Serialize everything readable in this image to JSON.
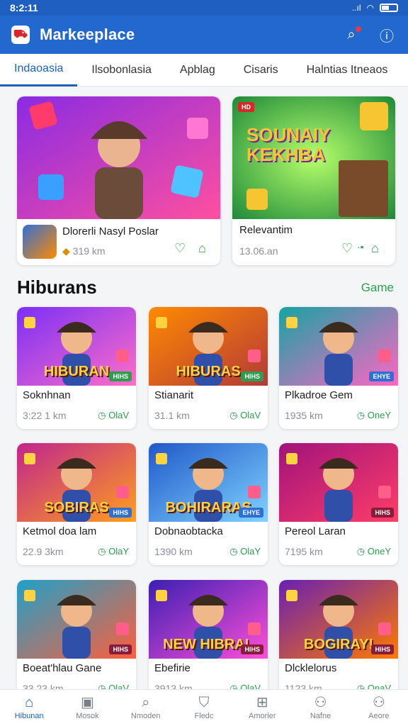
{
  "status": {
    "time": "8:2:11",
    "signal": "..ıl",
    "wifi": "◠"
  },
  "header": {
    "title": "Markeeplace",
    "logo": "marketplace-logo"
  },
  "tabs": [
    "Indaoasia",
    "Ilsobonlasia",
    "Apblag",
    "Cisaris",
    "Halntias Itneaos"
  ],
  "featured": [
    {
      "title": "Dlorerli Nasyl Poslar",
      "meta": "319 km",
      "colors": [
        "#8a2be2",
        "#ff4fa0"
      ]
    },
    {
      "title": "Relevantim",
      "meta": "13.06.an",
      "art_text": "SOUNAIY KEKHBA",
      "colors": [
        "#2ea043",
        "#f1c232"
      ]
    }
  ],
  "section": {
    "title": "Hiburans",
    "link": "Game"
  },
  "grid": [
    {
      "title": "Soknhnan",
      "meta": "3:22 1 km",
      "action": "OlaV",
      "art_text": "HIBURAN",
      "badge": "HIHS",
      "badge_color": "#2e9d4d",
      "colors": [
        "#7b2ff7",
        "#ff6ec7"
      ]
    },
    {
      "title": "Stianarit",
      "meta": "31.1 km",
      "action": "OlaV",
      "art_text": "HIBURAS",
      "badge": "HIHS",
      "badge_color": "#2e9d4d",
      "colors": [
        "#ff8a00",
        "#b33939"
      ]
    },
    {
      "title": "Plkadroe Gem",
      "meta": "1935 km",
      "action": "OneY",
      "art_text": "",
      "badge": "EHYE",
      "badge_color": "#2f6fd6",
      "colors": [
        "#16a3a3",
        "#ff66c4"
      ]
    },
    {
      "title": "Ketmol doa lam",
      "meta": "22.9 3km",
      "action": "OlaY",
      "art_text": "SOBIRAS",
      "badge": "HIHS",
      "badge_color": "#2f6fd6",
      "colors": [
        "#c0258d",
        "#ff9f1c"
      ]
    },
    {
      "title": "Dobnaobtacka",
      "meta": "1390 km",
      "action": "OlaY",
      "art_text": "BOHIRARAS",
      "badge": "EHYE",
      "badge_color": "#2f6fd6",
      "colors": [
        "#2058c9",
        "#7fd3ff"
      ]
    },
    {
      "title": "Pereol Laran",
      "meta": "7195 km",
      "action": "OneY",
      "art_text": "",
      "badge": "HIHS",
      "badge_color": "#8a1c3a",
      "colors": [
        "#a0137c",
        "#ff3d68"
      ]
    },
    {
      "title": "Boeat'hlau Gane",
      "meta": "33.23 km",
      "action": "OlaV",
      "art_text": "",
      "badge": "HIHS",
      "badge_color": "#8a1c3a",
      "colors": [
        "#1fa0c9",
        "#ff5e3a"
      ]
    },
    {
      "title": "Ebefirie",
      "meta": "3913 km",
      "action": "OlaV",
      "art_text": "NEW HIBRAL",
      "badge": "HIHS",
      "badge_color": "#8a1c3a",
      "colors": [
        "#3b1fb2",
        "#ff4fd8"
      ]
    },
    {
      "title": "Dlcklelorus",
      "meta": "1123 km",
      "action": "OnaV",
      "art_text": "BOGIRAY!",
      "badge": "HIHS",
      "badge_color": "#8a1c3a",
      "colors": [
        "#6a1fb2",
        "#ff7a00"
      ]
    }
  ],
  "bottom_nav": [
    {
      "label": "Hibunan",
      "icon": "home-icon",
      "glyph": "⌂"
    },
    {
      "label": "Mosok",
      "icon": "gallery-icon",
      "glyph": "▣"
    },
    {
      "label": "Nmoden",
      "icon": "search-icon",
      "glyph": "⌕"
    },
    {
      "label": "Fledc",
      "icon": "gift-icon",
      "glyph": "⛉"
    },
    {
      "label": "Amorier",
      "icon": "photo-icon",
      "glyph": "⊞"
    },
    {
      "label": "Nafne",
      "icon": "profile-icon",
      "glyph": "⚇"
    },
    {
      "label": "Aeore",
      "icon": "user-icon",
      "glyph": "⚇"
    }
  ]
}
